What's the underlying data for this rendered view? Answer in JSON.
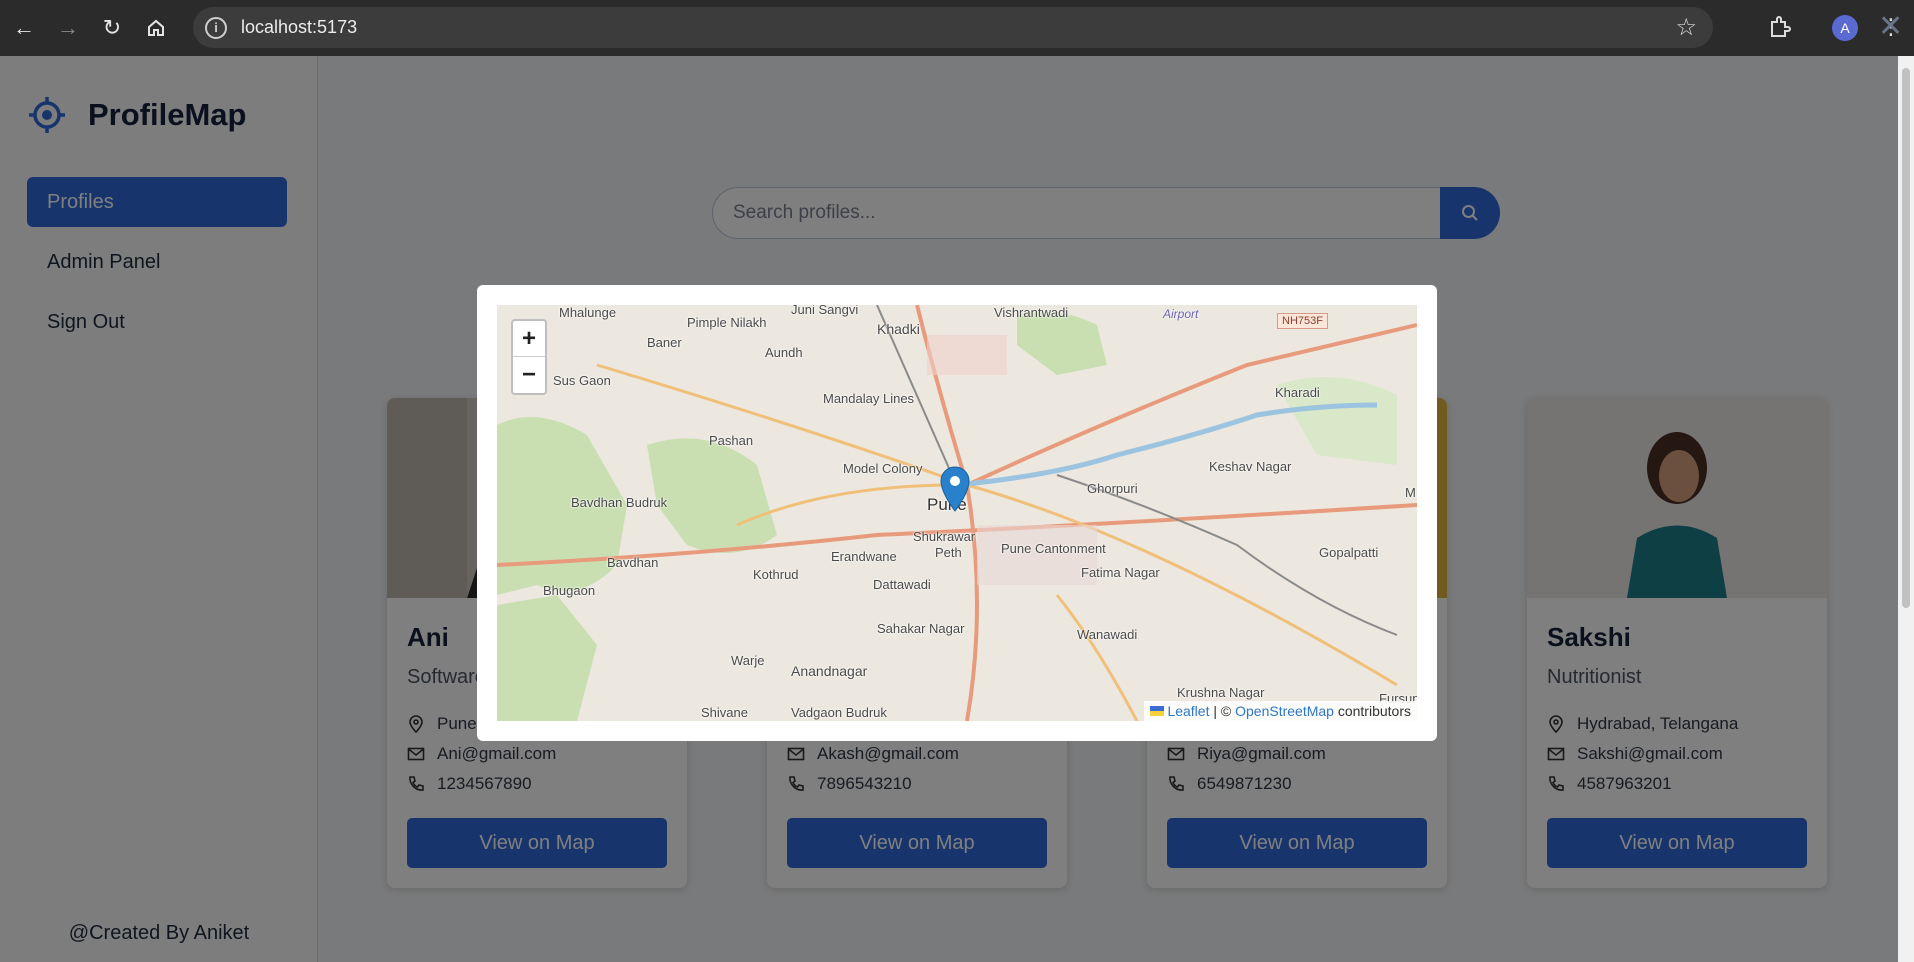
{
  "browser": {
    "url": "localhost:5173",
    "profile_initial": "A"
  },
  "sidebar": {
    "brand": "ProfileMap",
    "items": [
      {
        "label": "Profiles",
        "active": true
      },
      {
        "label": "Admin Panel",
        "active": false
      },
      {
        "label": "Sign Out",
        "active": false
      }
    ],
    "footer": "@Created By Aniket"
  },
  "search": {
    "placeholder": "Search profiles..."
  },
  "profiles": [
    {
      "name": "Ani",
      "role": "Software",
      "location": "Pune",
      "email": "Ani@gmail.com",
      "phone": "1234567890",
      "button": "View on Map"
    },
    {
      "name": "",
      "role": "",
      "location": "",
      "email": "Akash@gmail.com",
      "phone": "7896543210",
      "button": "View on Map"
    },
    {
      "name": "",
      "role": "",
      "location": "",
      "email": "Riya@gmail.com",
      "phone": "6549871230",
      "button": "View on Map"
    },
    {
      "name": "Sakshi",
      "role": "Nutritionist",
      "location": "Hydrabad, Telangana",
      "email": "Sakshi@gmail.com",
      "phone": "4587963201",
      "button": "View on Map"
    }
  ],
  "map": {
    "zoom_in": "+",
    "zoom_out": "−",
    "attribution": {
      "leaflet": "Leaflet",
      "separator": " | © ",
      "osm": "OpenStreetMap",
      "suffix": " contributors"
    },
    "labels": {
      "mhalunge": "Mhalunge",
      "juni_sangvi": "Juni Sangvi",
      "khadki": "Khadki",
      "vishrantwadi": "Vishrantwadi",
      "airport": "Airport",
      "nh": "NH753F",
      "pimple_nilakh": "Pimple Nilakh",
      "baner": "Baner",
      "aundh": "Aundh",
      "sus_gaon": "Sus Gaon",
      "mandalay_lines": "Mandalay Lines",
      "kharadi": "Kharadi",
      "pashan": "Pashan",
      "model_colony": "Model Colony",
      "keshav_nagar": "Keshav Nagar",
      "ghorpuri": "Ghorpuri",
      "bavdhan_budruk": "Bavdhan Budruk",
      "pune": "Pune",
      "shukrawar_peth": "Shukrawar",
      "peth": "Peth",
      "pune_cantonment": "Pune Cantonment",
      "bavdhan": "Bavdhan",
      "erandwane": "Erandwane",
      "gopalpatti": "Gopalpatti",
      "kothrud": "Kothrud",
      "fatima_nagar": "Fatima Nagar",
      "bhugaon": "Bhugaon",
      "dattawadi": "Dattawadi",
      "sahakar_nagar": "Sahakar Nagar",
      "wanawadi": "Wanawadi",
      "warje": "Warje",
      "anandnagar": "Anandnagar",
      "krushna_nagar": "Krushna Nagar",
      "shivane": "Shivane",
      "vadgaon_budruk": "Vadgaon Budruk",
      "fursun": "Fursun",
      "m": "M"
    }
  }
}
